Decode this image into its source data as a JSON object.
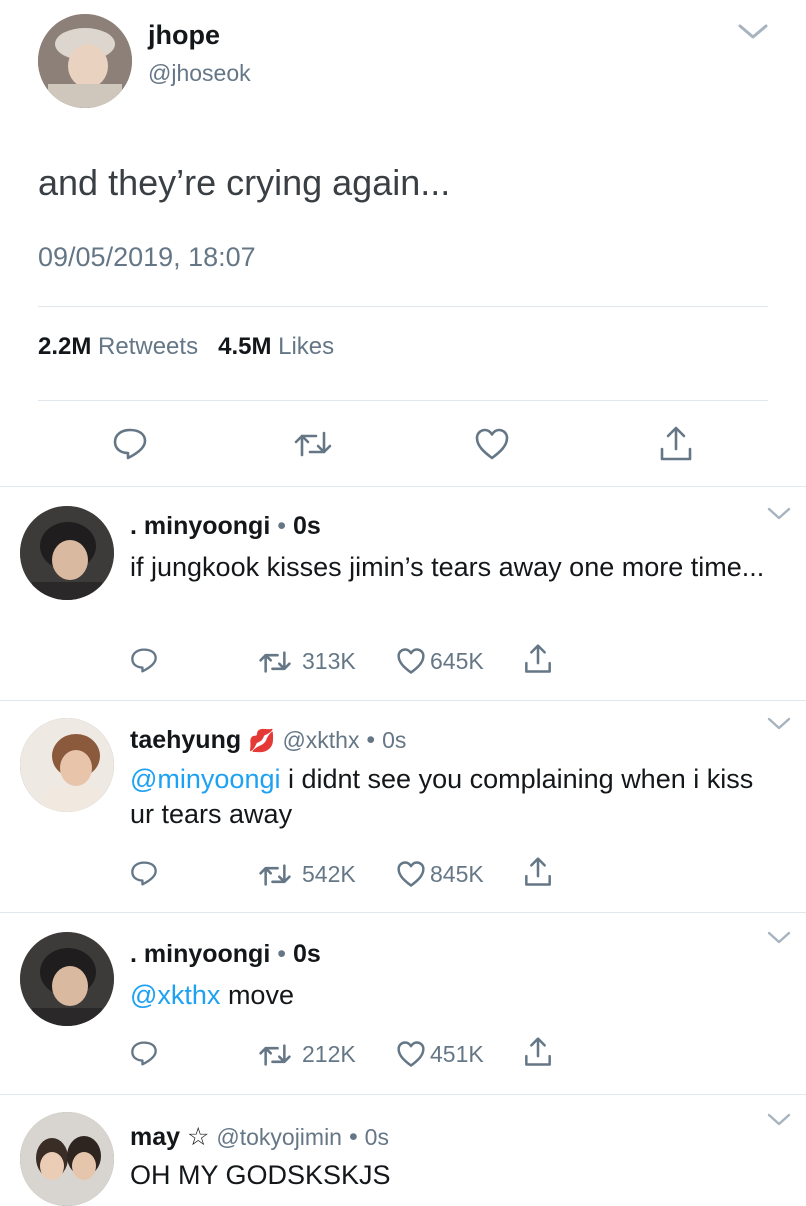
{
  "main_tweet": {
    "display_name": "jhope",
    "handle": "@jhoseok",
    "text": "and they’re crying again...",
    "timestamp": "09/05/2019, 18:07",
    "retweets_count": "2.2M",
    "retweets_label": "Retweets",
    "likes_count": "4.5M",
    "likes_label": "Likes"
  },
  "replies": [
    {
      "display_name": ". minyoongi",
      "separator": "•",
      "time": "0s",
      "text": "if jungkook kisses jimin’s tears away one more time...",
      "retweets": "313K",
      "likes": "645K"
    },
    {
      "display_name": "taehyung",
      "name_emoji": "💋",
      "handle": "@xkthx",
      "separator": "•",
      "time": "0s",
      "mention": "@minyoongi",
      "text": " i didnt see you complaining when i kiss ur tears away",
      "retweets": "542K",
      "likes": "845K"
    },
    {
      "display_name": ". minyoongi",
      "separator": "•",
      "time": "0s",
      "mention": "@xkthx",
      "text": " move",
      "retweets": "212K",
      "likes": "451K"
    },
    {
      "display_name": "may",
      "name_emoji": "☆",
      "handle": "@tokyojimin",
      "separator": "•",
      "time": "0s",
      "text": "OH MY GODSKSKJS"
    }
  ],
  "colors": {
    "text": "#14171a",
    "secondary": "#657786",
    "link": "#1da1f2",
    "divider": "#e1e8ed"
  },
  "icons": [
    "chevron-down-icon",
    "reply-icon",
    "retweet-icon",
    "like-icon",
    "share-icon"
  ]
}
